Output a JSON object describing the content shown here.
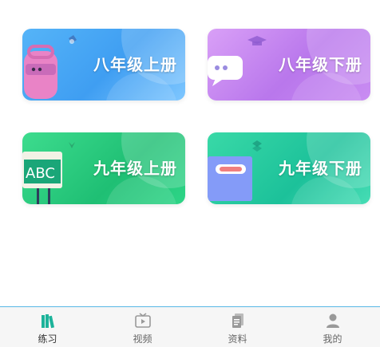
{
  "cards": [
    {
      "id": "card-1",
      "label": "八年级上册"
    },
    {
      "id": "card-2",
      "label": "八年级下册"
    },
    {
      "id": "card-3",
      "label": "九年级上册"
    },
    {
      "id": "card-4",
      "label": "九年级下册"
    }
  ],
  "card_art": {
    "card-3-board_text": "ABC"
  },
  "tabbar": {
    "tabs": [
      {
        "label": "练习",
        "icon": "books-icon",
        "active": true
      },
      {
        "label": "视频",
        "icon": "tv-play-icon",
        "active": false
      },
      {
        "label": "资料",
        "icon": "documents-icon",
        "active": false
      },
      {
        "label": "我的",
        "icon": "person-icon",
        "active": false
      }
    ]
  },
  "colors": {
    "active_tab": "#1cb39a",
    "inactive_tab": "#999999",
    "tabbar_border": "#57b8e6"
  }
}
